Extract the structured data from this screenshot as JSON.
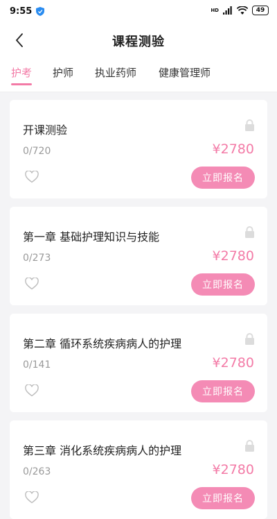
{
  "status_bar": {
    "time": "9:55",
    "battery": "49",
    "network": "HD"
  },
  "header": {
    "title": "课程测验"
  },
  "tabs": [
    {
      "label": "护考",
      "active": true
    },
    {
      "label": "护师",
      "active": false
    },
    {
      "label": "执业药师",
      "active": false
    },
    {
      "label": "健康管理师",
      "active": false
    }
  ],
  "courses": [
    {
      "title": "开课测验",
      "progress": "0/720",
      "price": "¥2780",
      "action": "立即报名"
    },
    {
      "title": "第一章 基础护理知识与技能",
      "progress": "0/273",
      "price": "¥2780",
      "action": "立即报名"
    },
    {
      "title": "第二章 循环系统疾病病人的护理",
      "progress": "0/141",
      "price": "¥2780",
      "action": "立即报名"
    },
    {
      "title": "第三章 消化系统疾病病人的护理",
      "progress": "0/263",
      "price": "¥2780",
      "action": "立即报名"
    }
  ],
  "icons": {
    "back": "chevron-left-icon",
    "lock": "lock-icon",
    "favorite": "heart-icon"
  },
  "colors": {
    "accent": "#f37aa6",
    "button": "#f48bb5",
    "background": "#f4f4f6"
  }
}
